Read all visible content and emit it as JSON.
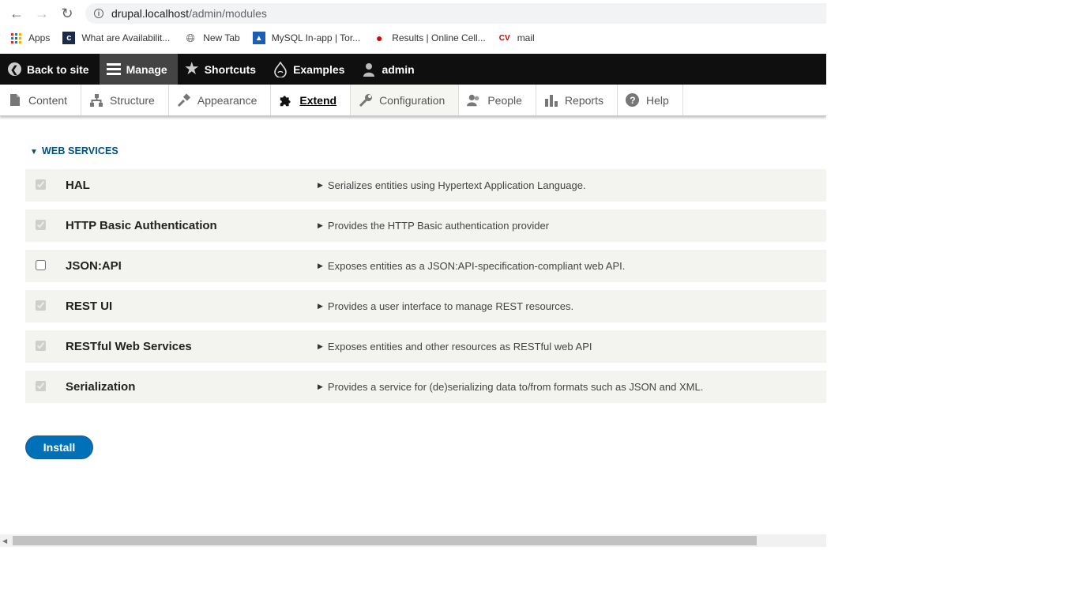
{
  "browser": {
    "url_host": "drupal.localhost",
    "url_path": "/admin/modules",
    "bookmarks": [
      {
        "label": "Apps"
      },
      {
        "label": "What are Availabilit..."
      },
      {
        "label": "New Tab"
      },
      {
        "label": "MySQL In-app | Tor..."
      },
      {
        "label": "Results | Online Cell..."
      },
      {
        "label": "mail"
      }
    ]
  },
  "toolbar": {
    "back_to_site": "Back to site",
    "manage": "Manage",
    "shortcuts": "Shortcuts",
    "examples": "Examples",
    "user": "admin"
  },
  "tray": {
    "items": [
      {
        "label": "Content",
        "icon": "document-icon"
      },
      {
        "label": "Structure",
        "icon": "structure-icon"
      },
      {
        "label": "Appearance",
        "icon": "brush-icon"
      },
      {
        "label": "Extend",
        "icon": "puzzle-icon",
        "active": true
      },
      {
        "label": "Configuration",
        "icon": "wrench-icon"
      },
      {
        "label": "People",
        "icon": "people-icon"
      },
      {
        "label": "Reports",
        "icon": "reports-icon"
      },
      {
        "label": "Help",
        "icon": "help-icon"
      }
    ]
  },
  "section": {
    "title": "WEB SERVICES"
  },
  "modules": [
    {
      "name": "HAL",
      "description": "Serializes entities using Hypertext Application Language.",
      "checked": true,
      "disabled": true
    },
    {
      "name": "HTTP Basic Authentication",
      "description": "Provides the HTTP Basic authentication provider",
      "checked": true,
      "disabled": true
    },
    {
      "name": "JSON:API",
      "description": "Exposes entities as a JSON:API-specification-compliant web API.",
      "checked": false,
      "disabled": false
    },
    {
      "name": "REST UI",
      "description": "Provides a user interface to manage REST resources.",
      "checked": true,
      "disabled": true
    },
    {
      "name": "RESTful Web Services",
      "description": "Exposes entities and other resources as RESTful web API",
      "checked": true,
      "disabled": true
    },
    {
      "name": "Serialization",
      "description": "Provides a service for (de)serializing data to/from formats such as JSON and XML.",
      "checked": true,
      "disabled": true
    }
  ],
  "actions": {
    "install_label": "Install"
  },
  "colors": {
    "toolbar_bg": "#0f0f0f",
    "link_blue": "#004f80",
    "button_blue": "#0071b8",
    "row_bg": "#f3f3f0"
  }
}
